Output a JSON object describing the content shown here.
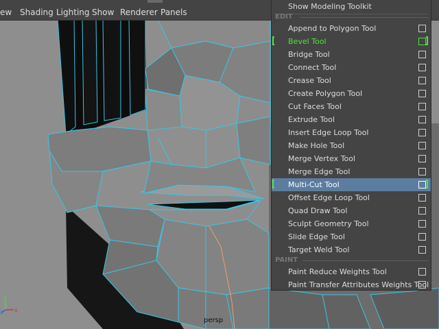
{
  "menubar": {
    "items": [
      "ew",
      "Shading",
      "Lighting",
      "Show",
      "Renderer",
      "Panels"
    ]
  },
  "popup": {
    "top_item": "Show Modeling Toolkit",
    "sections": [
      {
        "title": "EDIT",
        "items": [
          {
            "label": "Append to Polygon Tool"
          },
          {
            "label": "Bevel Tool",
            "state": "recent"
          },
          {
            "label": "Bridge Tool"
          },
          {
            "label": "Connect Tool"
          },
          {
            "label": "Crease Tool"
          },
          {
            "label": "Create Polygon Tool"
          },
          {
            "label": "Cut Faces Tool"
          },
          {
            "label": "Extrude Tool"
          },
          {
            "label": "Insert Edge Loop Tool"
          },
          {
            "label": "Make Hole Tool"
          },
          {
            "label": "Merge Vertex Tool"
          },
          {
            "label": "Merge Edge Tool"
          },
          {
            "label": "Multi-Cut Tool",
            "state": "highlighted"
          },
          {
            "label": "Offset Edge Loop Tool"
          },
          {
            "label": "Quad Draw Tool"
          },
          {
            "label": "Sculpt Geometry Tool"
          },
          {
            "label": "Slide Edge Tool"
          },
          {
            "label": "Target Weld Tool"
          }
        ]
      },
      {
        "title": "PAINT",
        "items": [
          {
            "label": "Paint Reduce Weights Tool"
          },
          {
            "label": "Paint Transfer Attributes Weights Tool"
          }
        ]
      }
    ]
  },
  "viewport": {
    "camera_label": "persp",
    "axis_labels": [
      "y",
      "x",
      "z"
    ]
  },
  "colors": {
    "menu_bg": "#444444",
    "wireframe": "#39c6e6",
    "recent_tool": "#4fe43b",
    "highlight": "#5c7d9f",
    "mesh_face": "#7e7e7e"
  }
}
